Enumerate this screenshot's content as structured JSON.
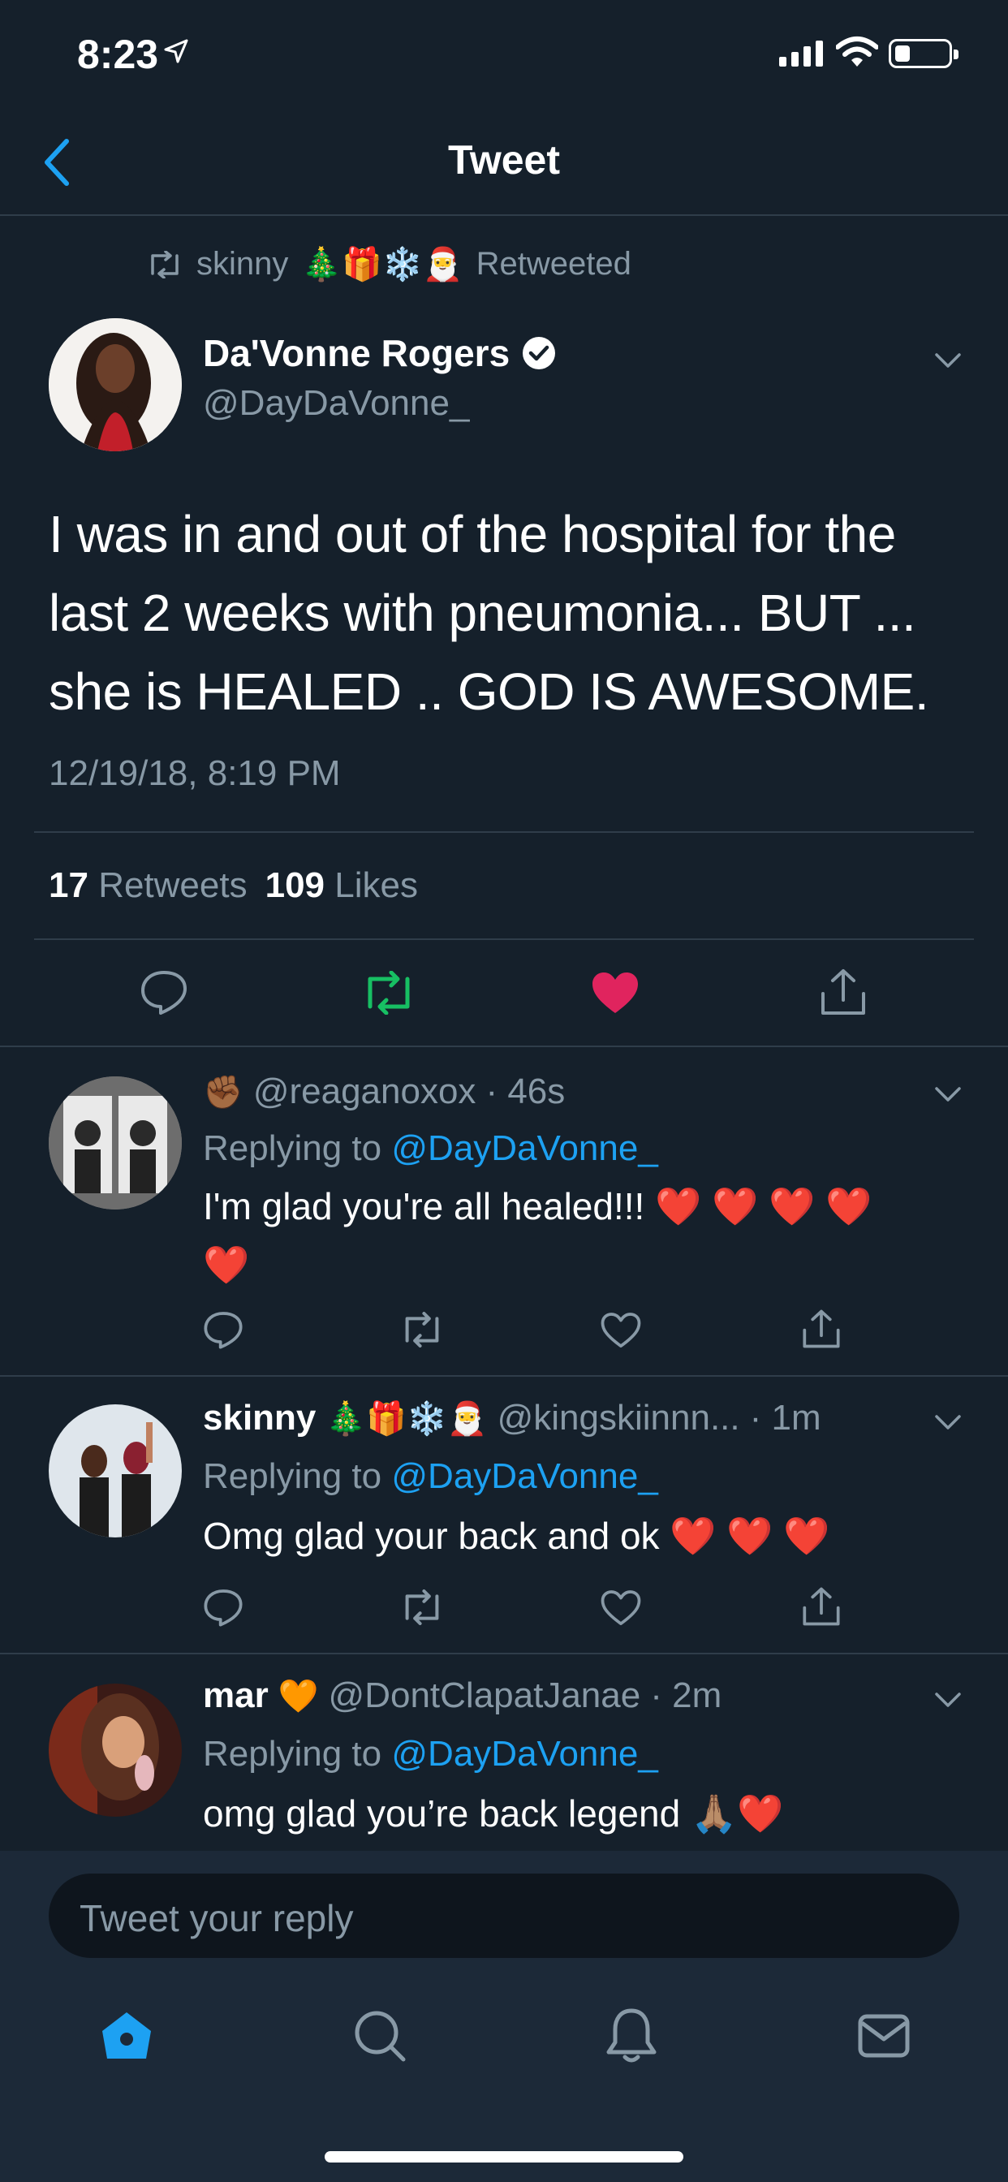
{
  "status_bar": {
    "time": "8:23"
  },
  "header": {
    "title": "Tweet"
  },
  "retweet": {
    "user": "skinny",
    "emojis": "🎄🎁❄️🎅",
    "label": "Retweeted"
  },
  "tweet": {
    "name": "Da'Vonne Rogers",
    "handle": "@DayDaVonne_",
    "text_lines": [
      "I was in and out of the hospital for the",
      "last 2 weeks with pneumonia... BUT ...",
      "she is HEALED .. GOD IS AWESOME."
    ],
    "timestamp": "12/19/18, 8:19 PM",
    "retweets_count": "17",
    "retweets_label": "Retweets",
    "likes_count": "109",
    "likes_label": "Likes"
  },
  "replies": [
    {
      "name": "",
      "name_emoji": "✊🏾",
      "handle": "@reaganoxox",
      "time": "· 46s",
      "replying_prefix": "Replying to",
      "replying_to": "@DayDaVonne_",
      "text": "I'm glad you're all healed!!! ❤️ ❤️ ❤️ ❤️",
      "text2": "❤️"
    },
    {
      "name": "skinny",
      "name_emoji": "🎄🎁❄️🎅",
      "handle": "@kingskiinnn...",
      "time": "· 1m",
      "replying_prefix": "Replying to",
      "replying_to": "@DayDaVonne_",
      "text": "Omg glad your back and ok ❤️ ❤️ ❤️"
    },
    {
      "name": "mar",
      "name_emoji": "🧡",
      "handle": "@DontClapatJanae",
      "time": "· 2m",
      "replying_prefix": "Replying to",
      "replying_to": "@DayDaVonne_",
      "text": "omg glad you’re back legend 🙏🏽❤️"
    }
  ],
  "composer": {
    "placeholder": "Tweet your reply"
  },
  "tab_bar": {
    "items": [
      "home-icon",
      "search-icon",
      "notifications-icon",
      "messages-icon"
    ],
    "active_color": "#1da1f2"
  },
  "colors": {
    "background": "#15202b",
    "muted": "#8899a6",
    "accent": "#1da1f2",
    "retweet": "#17bf63",
    "like": "#e0245e"
  }
}
